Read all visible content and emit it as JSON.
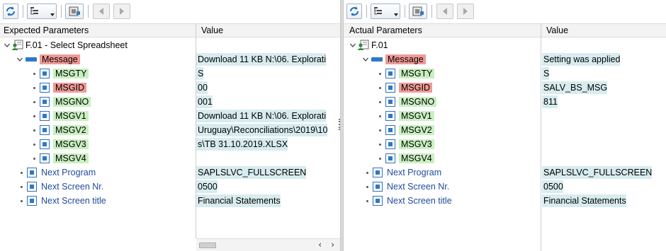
{
  "left": {
    "columns": {
      "param": "Expected Parameters",
      "value": "Value"
    },
    "root_label": "F.01 - Select Spreadsheet",
    "rows": [
      {
        "label": "Message",
        "value": "Download 11 KB N:\\06. Explorati",
        "style": "red",
        "kind": "struct"
      },
      {
        "label": "MSGTY",
        "value": "S",
        "style": "green",
        "kind": "field"
      },
      {
        "label": "MSGID",
        "value": "00",
        "style": "red",
        "kind": "field"
      },
      {
        "label": "MSGNO",
        "value": "001",
        "style": "green",
        "kind": "field"
      },
      {
        "label": "MSGV1",
        "value": "Download 11 KB N:\\06. Explorati",
        "style": "green",
        "kind": "field"
      },
      {
        "label": "MSGV2",
        "value": "Uruguay\\Reconciliations\\2019\\10",
        "style": "green",
        "kind": "field"
      },
      {
        "label": "MSGV3",
        "value": "s\\TB 31.10.2019.XLSX",
        "style": "green",
        "kind": "field"
      },
      {
        "label": "MSGV4",
        "value": "",
        "style": "green",
        "kind": "field"
      },
      {
        "label": "Next Program",
        "value": "SAPLSLVC_FULLSCREEN",
        "style": "blue",
        "kind": "top"
      },
      {
        "label": "Next Screen Nr.",
        "value": "0500",
        "style": "blue",
        "kind": "top"
      },
      {
        "label": "Next Screen title",
        "value": "Financial Statements",
        "style": "blue",
        "kind": "top"
      }
    ]
  },
  "right": {
    "columns": {
      "param": "Actual Parameters",
      "value": "Value"
    },
    "root_label": "F.01",
    "rows": [
      {
        "label": "Message",
        "value": "Setting was applied",
        "style": "red",
        "kind": "struct"
      },
      {
        "label": "MSGTY",
        "value": "S",
        "style": "green",
        "kind": "field"
      },
      {
        "label": "MSGID",
        "value": "SALV_BS_MSG",
        "style": "red",
        "kind": "field"
      },
      {
        "label": "MSGNO",
        "value": "811",
        "style": "green",
        "kind": "field"
      },
      {
        "label": "MSGV1",
        "value": "",
        "style": "green",
        "kind": "field"
      },
      {
        "label": "MSGV2",
        "value": "",
        "style": "green",
        "kind": "field"
      },
      {
        "label": "MSGV3",
        "value": "",
        "style": "green",
        "kind": "field"
      },
      {
        "label": "MSGV4",
        "value": "",
        "style": "green",
        "kind": "field"
      },
      {
        "label": "Next Program",
        "value": "SAPLSLVC_FULLSCREEN",
        "style": "blue",
        "kind": "top"
      },
      {
        "label": "Next Screen Nr.",
        "value": "0500",
        "style": "blue",
        "kind": "top"
      },
      {
        "label": "Next Screen title",
        "value": "Financial Statements",
        "style": "blue",
        "kind": "top"
      }
    ]
  },
  "colors": {
    "red_highlight": "#f09a96",
    "green_highlight": "#c9f0c1",
    "value_highlight": "#d8ecef",
    "link_blue": "#1f4a9c"
  },
  "icons": [
    "refresh-icon",
    "tree-settings-icon",
    "print-icon",
    "nav-back-icon",
    "nav-forward-icon",
    "person-icon",
    "field-icon",
    "structure-icon"
  ]
}
